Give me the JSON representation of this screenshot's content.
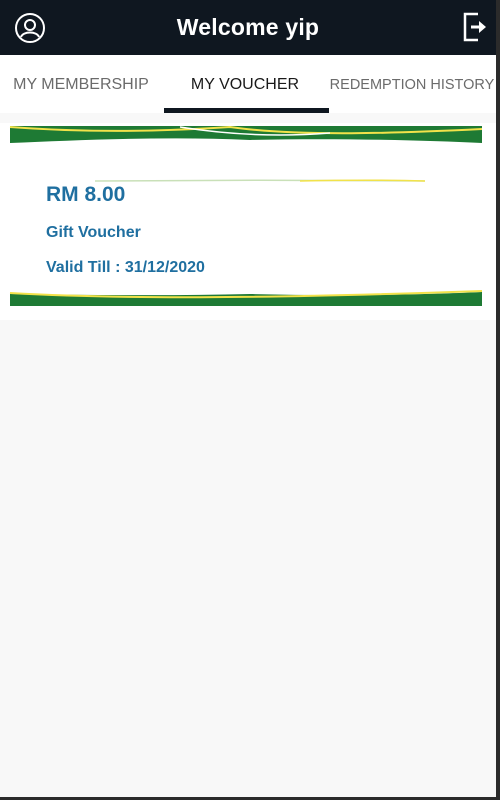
{
  "header": {
    "title": "Welcome yip",
    "left_icon": "user-profile-icon",
    "right_icon": "logout-icon"
  },
  "tabs": [
    {
      "label": "MY MEMBERSHIP",
      "active": false
    },
    {
      "label": "MY VOUCHER",
      "active": true
    },
    {
      "label": "REDEMPTION HISTORY",
      "active": false
    }
  ],
  "voucher": {
    "amount": "RM 8.00",
    "type": "Gift Voucher",
    "validity": "Valid Till : 31/12/2020"
  },
  "colors": {
    "header_bg": "#0f1720",
    "accent_text": "#1f6fa0",
    "band_green": "#1e7a34",
    "band_yellow": "#f2e24a",
    "page_bg": "#f8f8f8"
  }
}
